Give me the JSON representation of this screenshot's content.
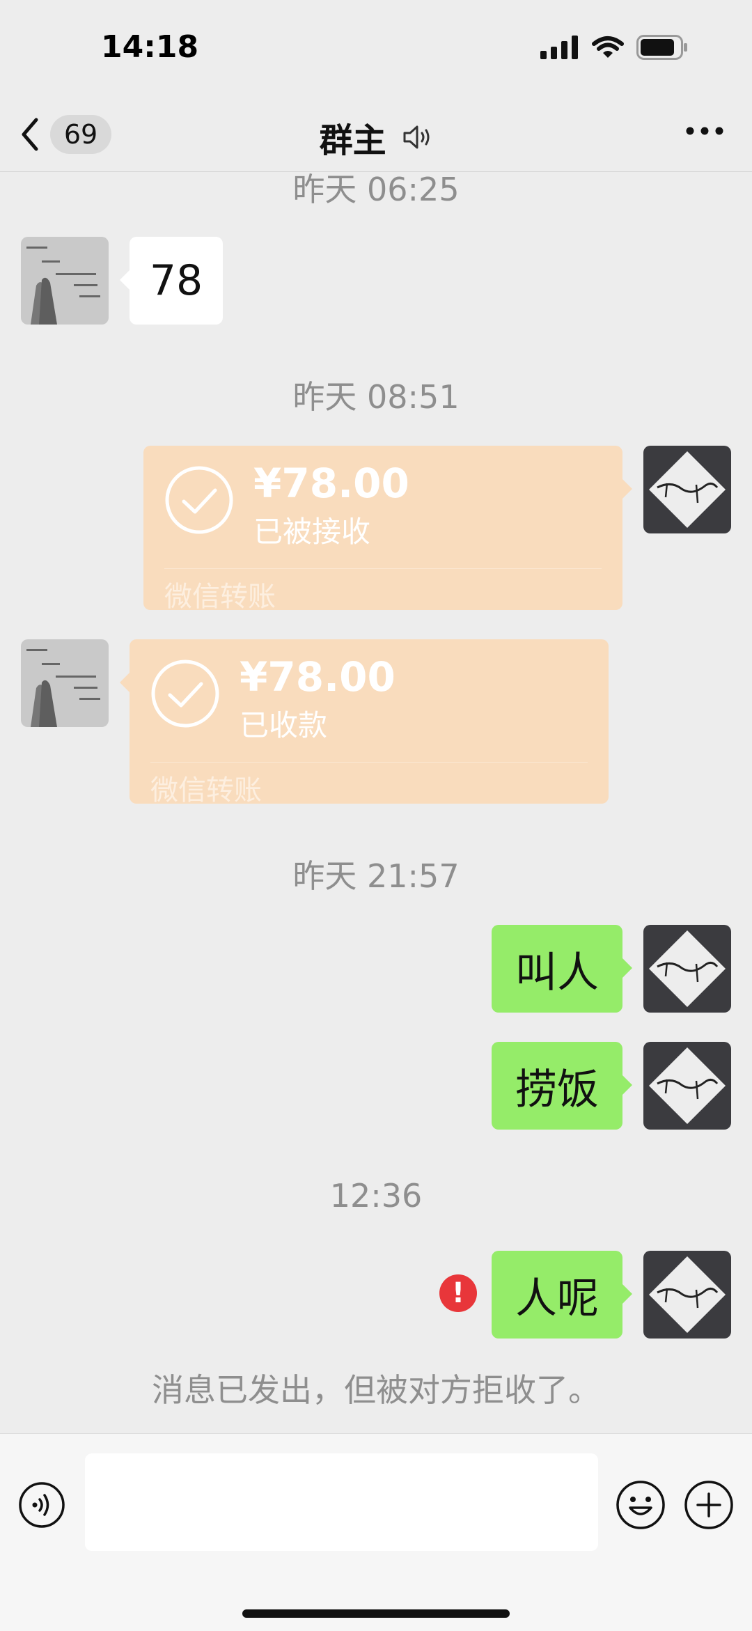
{
  "status_bar": {
    "time": "14:18"
  },
  "nav": {
    "unread_count": "69",
    "title": "群主"
  },
  "messages": {
    "ts1": "昨天 06:25",
    "msg1_text": "78",
    "ts2": "昨天 08:51",
    "transfer_sent": {
      "amount": "¥78.00",
      "status": "已被接收",
      "label": "微信转账"
    },
    "transfer_received": {
      "amount": "¥78.00",
      "status": "已收款",
      "label": "微信转账"
    },
    "ts3": "昨天 21:57",
    "msg2_text": "叫人",
    "msg3_text": "捞饭",
    "ts4": "12:36",
    "msg4_text": "人呢",
    "msg4_error": "!",
    "notice": "消息已发出，但被对方拒收了。"
  },
  "colors": {
    "bubble_self": "#95ec69",
    "bubble_other": "#ffffff",
    "transfer_bg": "#f9dcbd",
    "error_red": "#e8363a",
    "background": "#ededed"
  }
}
